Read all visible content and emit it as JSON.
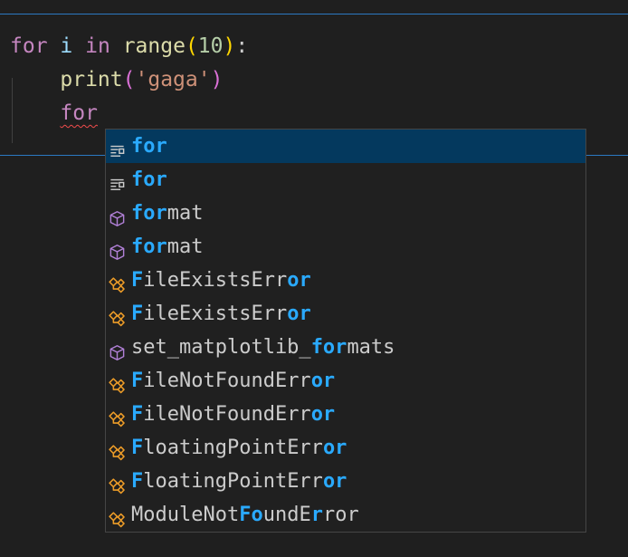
{
  "editor": {
    "lines": [
      {
        "tokens": [
          {
            "text": "for",
            "cls": "kw"
          },
          {
            "text": " ",
            "cls": "plain"
          },
          {
            "text": "i",
            "cls": "var"
          },
          {
            "text": " ",
            "cls": "plain"
          },
          {
            "text": "in",
            "cls": "kw"
          },
          {
            "text": " ",
            "cls": "plain"
          },
          {
            "text": "range",
            "cls": "fn"
          },
          {
            "text": "(",
            "cls": "paren1"
          },
          {
            "text": "10",
            "cls": "num"
          },
          {
            "text": ")",
            "cls": "paren1"
          },
          {
            "text": ":",
            "cls": "plain"
          }
        ]
      },
      {
        "tokens": [
          {
            "text": "    ",
            "cls": "plain"
          },
          {
            "text": "print",
            "cls": "fn"
          },
          {
            "text": "(",
            "cls": "paren2"
          },
          {
            "text": "'gaga'",
            "cls": "str"
          },
          {
            "text": ")",
            "cls": "paren2"
          }
        ]
      },
      {
        "tokens": [
          {
            "text": "    ",
            "cls": "plain"
          },
          {
            "text": "for",
            "cls": "kw squiggle"
          }
        ]
      }
    ]
  },
  "suggestions": {
    "items": [
      {
        "icon": "snippet-icon",
        "parts": [
          {
            "t": "for",
            "h": true
          }
        ],
        "selected": true
      },
      {
        "icon": "snippet-icon",
        "parts": [
          {
            "t": "for",
            "h": true
          }
        ],
        "selected": false
      },
      {
        "icon": "method-icon",
        "parts": [
          {
            "t": "for",
            "h": true
          },
          {
            "t": "mat",
            "h": false
          }
        ],
        "selected": false
      },
      {
        "icon": "method-icon",
        "parts": [
          {
            "t": "for",
            "h": true
          },
          {
            "t": "mat",
            "h": false
          }
        ],
        "selected": false
      },
      {
        "icon": "class-icon",
        "parts": [
          {
            "t": "F",
            "h": true
          },
          {
            "t": "ileExistsErr",
            "h": false
          },
          {
            "t": "or",
            "h": true
          }
        ],
        "selected": false
      },
      {
        "icon": "class-icon",
        "parts": [
          {
            "t": "F",
            "h": true
          },
          {
            "t": "ileExistsErr",
            "h": false
          },
          {
            "t": "or",
            "h": true
          }
        ],
        "selected": false
      },
      {
        "icon": "method-icon",
        "parts": [
          {
            "t": "set_matplotlib_",
            "h": false
          },
          {
            "t": "for",
            "h": true
          },
          {
            "t": "mats",
            "h": false
          }
        ],
        "selected": false
      },
      {
        "icon": "class-icon",
        "parts": [
          {
            "t": "F",
            "h": true
          },
          {
            "t": "ileNotFoundErr",
            "h": false
          },
          {
            "t": "or",
            "h": true
          }
        ],
        "selected": false
      },
      {
        "icon": "class-icon",
        "parts": [
          {
            "t": "F",
            "h": true
          },
          {
            "t": "ileNotFoundErr",
            "h": false
          },
          {
            "t": "or",
            "h": true
          }
        ],
        "selected": false
      },
      {
        "icon": "class-icon",
        "parts": [
          {
            "t": "F",
            "h": true
          },
          {
            "t": "loatingPointErr",
            "h": false
          },
          {
            "t": "or",
            "h": true
          }
        ],
        "selected": false
      },
      {
        "icon": "class-icon",
        "parts": [
          {
            "t": "F",
            "h": true
          },
          {
            "t": "loatingPointErr",
            "h": false
          },
          {
            "t": "or",
            "h": true
          }
        ],
        "selected": false
      },
      {
        "icon": "class-icon",
        "parts": [
          {
            "t": "ModuleNot",
            "h": false
          },
          {
            "t": "Fo",
            "h": true
          },
          {
            "t": "undE",
            "h": false
          },
          {
            "t": "r",
            "h": true
          },
          {
            "t": "ror",
            "h": false
          }
        ],
        "selected": false
      }
    ]
  },
  "colors": {
    "match_highlight": "#2aaaff",
    "selected_row": "#04395e",
    "cell_border": "#2b79c2",
    "snippet_icon": "#cccccc",
    "method_icon": "#b180d7",
    "class_icon": "#ee9d28"
  }
}
